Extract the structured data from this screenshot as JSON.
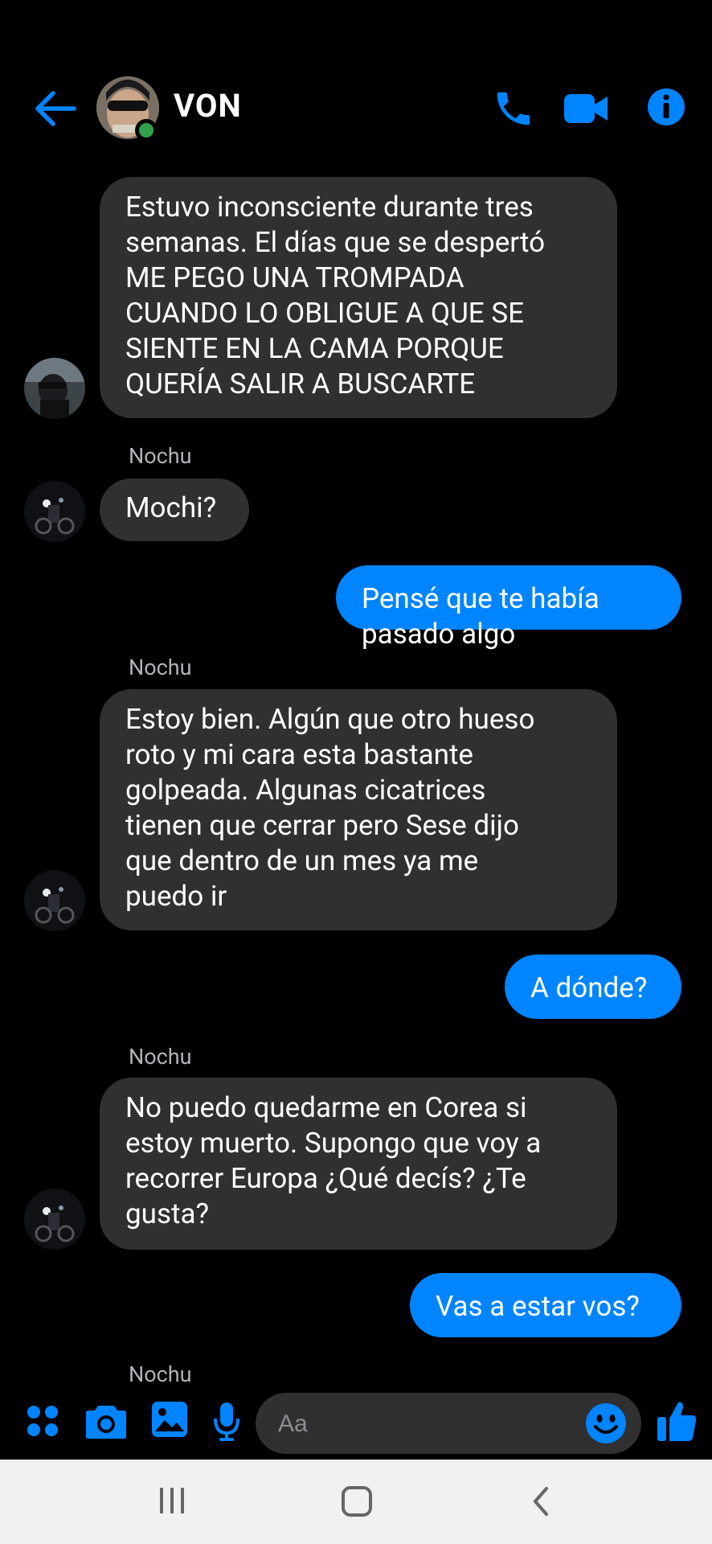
{
  "header": {
    "contact_name": "VON"
  },
  "colors": {
    "accent": "#0084ff",
    "incoming_bubble": "#303030",
    "online": "#31a24c",
    "background": "#000000"
  },
  "icons": {
    "back": "arrow-left-icon",
    "call": "phone-icon",
    "video": "video-camera-icon",
    "info": "info-icon",
    "menu": "four-dots-icon",
    "camera": "camera-icon",
    "gallery": "image-icon",
    "mic": "microphone-icon",
    "emoji": "smiley-icon",
    "like": "thumbs-up-icon"
  },
  "messages": [
    {
      "from": "them",
      "sender": "",
      "lines": [
        "Estuvo inconsciente durante tres",
        "semanas. El días que se despertó",
        "ME PEGO UNA TROMPADA",
        "CUANDO LO OBLIGUE A QUE SE",
        "SIENTE EN LA CAMA PORQUE",
        "QUERÍA SALIR A BUSCARTE"
      ]
    },
    {
      "from": "them",
      "sender": "Nochu",
      "lines": [
        "Mochi?"
      ]
    },
    {
      "from": "me",
      "lines": [
        "Pensé que te había pasado algo"
      ]
    },
    {
      "from": "them",
      "sender": "Nochu",
      "lines": [
        "Estoy bien. Algún que otro hueso",
        "roto y mi cara esta bastante",
        "golpeada. Algunas cicatrices",
        "tienen que cerrar pero Sese dijo",
        "que dentro de un mes ya me",
        "puedo ir"
      ]
    },
    {
      "from": "me",
      "lines": [
        "A dónde?"
      ]
    },
    {
      "from": "them",
      "sender": "Nochu",
      "lines": [
        "No puedo quedarme en Corea si",
        "estoy muerto. Supongo que voy a",
        "recorrer Europa ¿Qué decís? ¿Te",
        "gusta?"
      ]
    },
    {
      "from": "me",
      "lines": [
        "Vas a estar vos?"
      ]
    },
    {
      "from": "them",
      "sender": "Nochu",
      "lines": []
    }
  ],
  "composer": {
    "placeholder": "Aa"
  }
}
